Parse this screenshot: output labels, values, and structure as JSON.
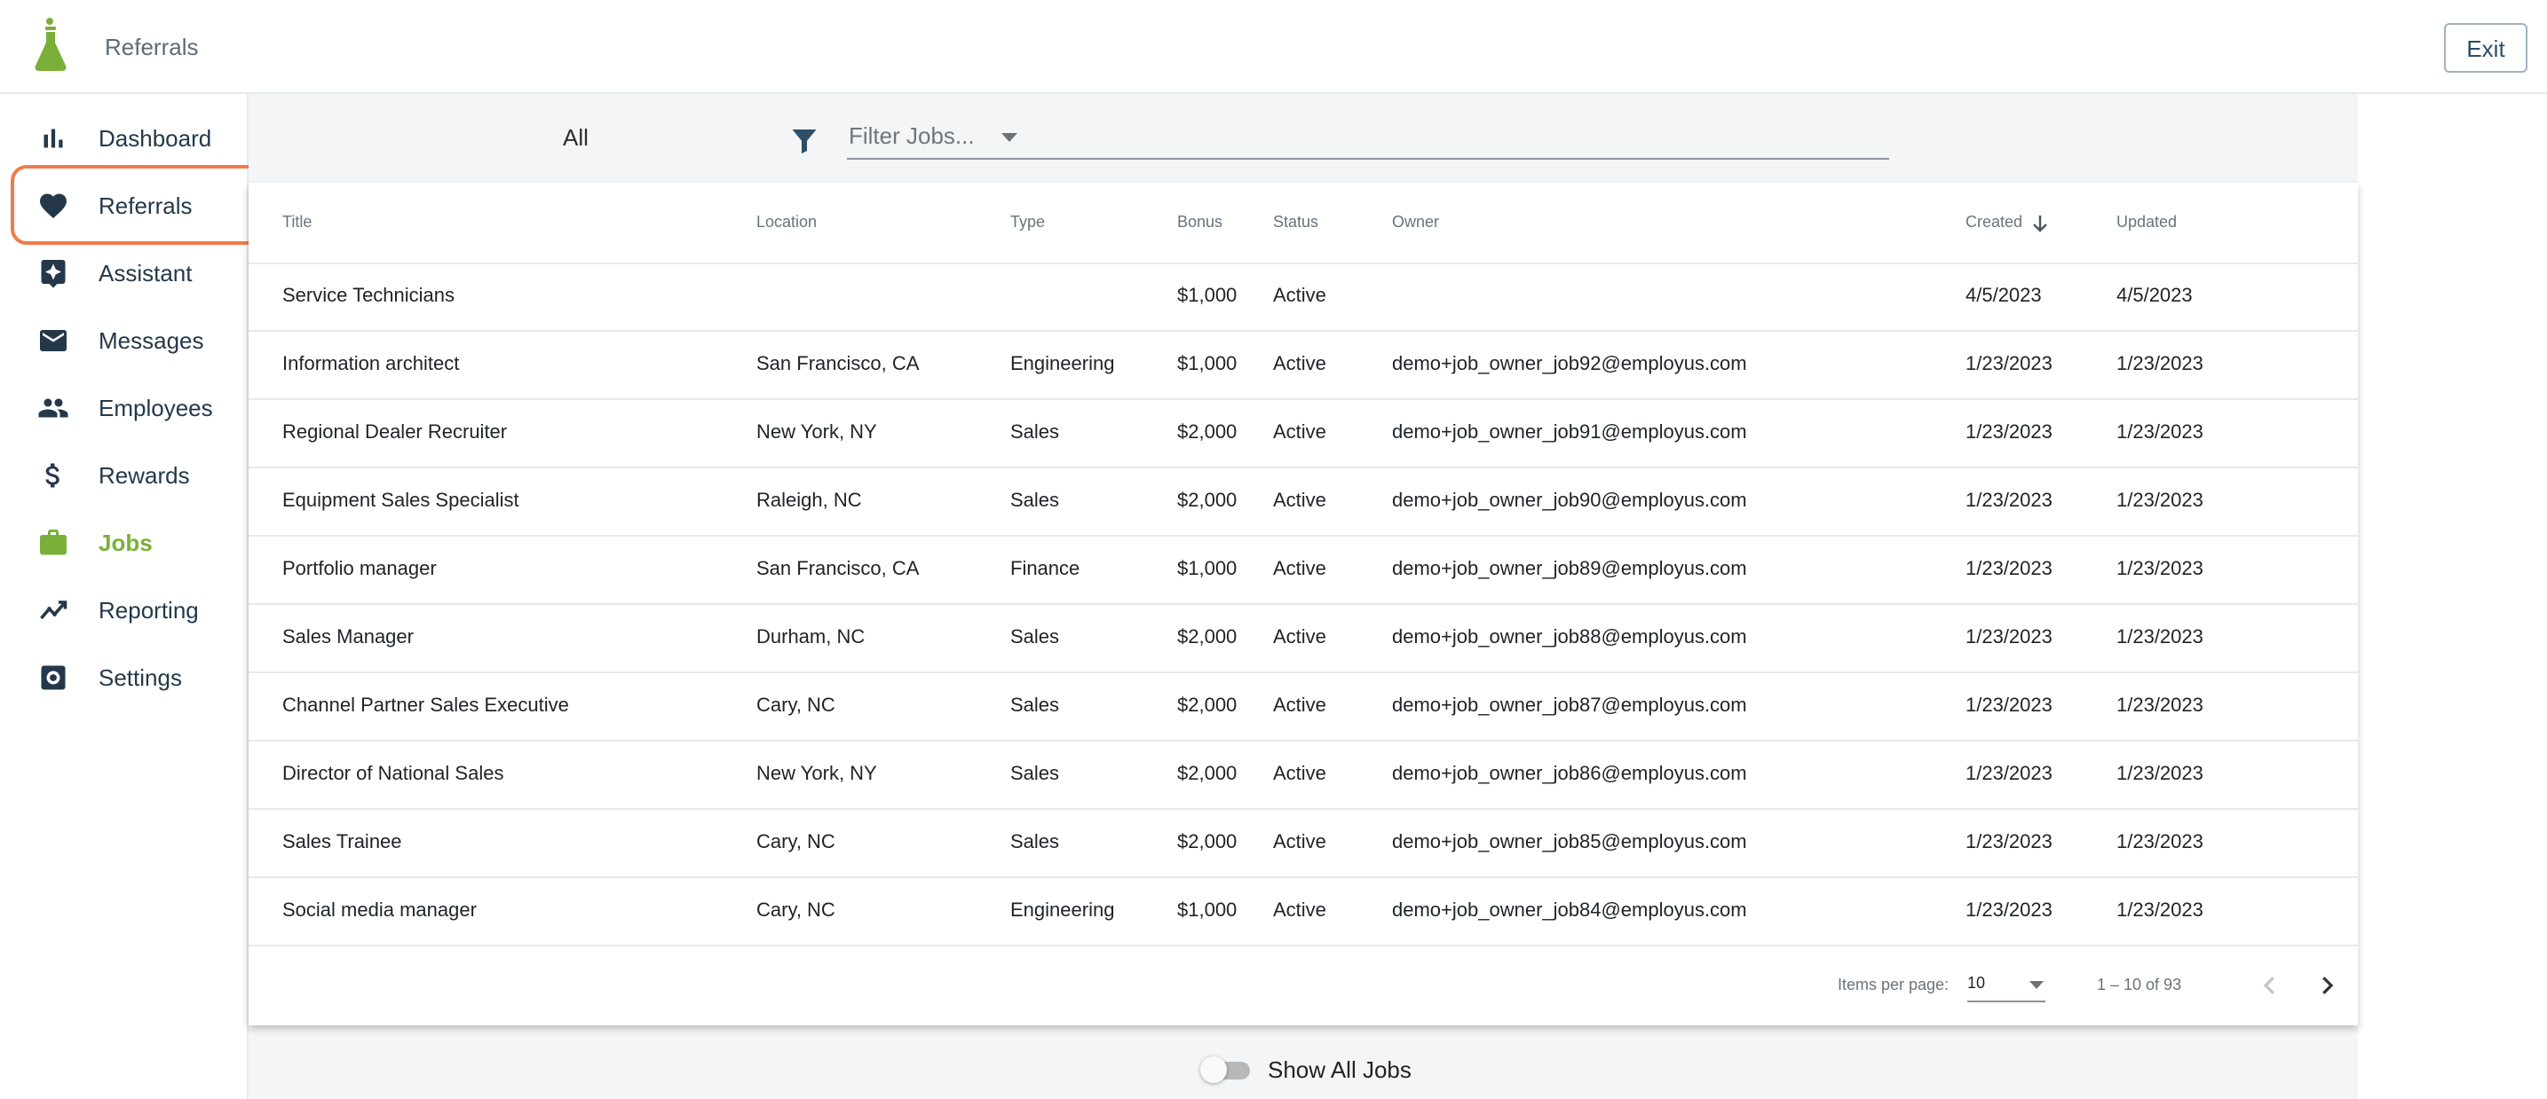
{
  "header": {
    "title": "Referrals",
    "exit_label": "Exit"
  },
  "sidebar": {
    "items": [
      {
        "label": "Dashboard",
        "icon": "bar-chart-icon",
        "active": false
      },
      {
        "label": "Referrals",
        "icon": "heart-icon",
        "active": false
      },
      {
        "label": "Assistant",
        "icon": "assistant-icon",
        "active": false
      },
      {
        "label": "Messages",
        "icon": "mail-icon",
        "active": false
      },
      {
        "label": "Employees",
        "icon": "people-icon",
        "active": false
      },
      {
        "label": "Rewards",
        "icon": "dollar-icon",
        "active": false
      },
      {
        "label": "Jobs",
        "icon": "briefcase-icon",
        "active": true
      },
      {
        "label": "Reporting",
        "icon": "trending-icon",
        "active": false
      },
      {
        "label": "Settings",
        "icon": "settings-icon",
        "active": false
      }
    ]
  },
  "filter": {
    "select_value": "All",
    "placeholder": "Filter Jobs..."
  },
  "table": {
    "columns": {
      "title": "Title",
      "location": "Location",
      "type": "Type",
      "bonus": "Bonus",
      "status": "Status",
      "owner": "Owner",
      "created": "Created",
      "updated": "Updated"
    },
    "sort_column": "created",
    "sort_direction": "desc",
    "rows": [
      {
        "title": "Service Technicians",
        "location": "",
        "type": "",
        "bonus": "$1,000",
        "status": "Active",
        "owner": "",
        "created": "4/5/2023",
        "updated": "4/5/2023"
      },
      {
        "title": "Information architect",
        "location": "San Francisco, CA",
        "type": "Engineering",
        "bonus": "$1,000",
        "status": "Active",
        "owner": "demo+job_owner_job92@employus.com",
        "created": "1/23/2023",
        "updated": "1/23/2023"
      },
      {
        "title": "Regional Dealer Recruiter",
        "location": "New York, NY",
        "type": "Sales",
        "bonus": "$2,000",
        "status": "Active",
        "owner": "demo+job_owner_job91@employus.com",
        "created": "1/23/2023",
        "updated": "1/23/2023"
      },
      {
        "title": "Equipment Sales Specialist",
        "location": "Raleigh, NC",
        "type": "Sales",
        "bonus": "$2,000",
        "status": "Active",
        "owner": "demo+job_owner_job90@employus.com",
        "created": "1/23/2023",
        "updated": "1/23/2023"
      },
      {
        "title": "Portfolio manager",
        "location": "San Francisco, CA",
        "type": "Finance",
        "bonus": "$1,000",
        "status": "Active",
        "owner": "demo+job_owner_job89@employus.com",
        "created": "1/23/2023",
        "updated": "1/23/2023"
      },
      {
        "title": "Sales Manager",
        "location": "Durham, NC",
        "type": "Sales",
        "bonus": "$2,000",
        "status": "Active",
        "owner": "demo+job_owner_job88@employus.com",
        "created": "1/23/2023",
        "updated": "1/23/2023"
      },
      {
        "title": "Channel Partner Sales Executive",
        "location": "Cary, NC",
        "type": "Sales",
        "bonus": "$2,000",
        "status": "Active",
        "owner": "demo+job_owner_job87@employus.com",
        "created": "1/23/2023",
        "updated": "1/23/2023"
      },
      {
        "title": "Director of National Sales",
        "location": "New York, NY",
        "type": "Sales",
        "bonus": "$2,000",
        "status": "Active",
        "owner": "demo+job_owner_job86@employus.com",
        "created": "1/23/2023",
        "updated": "1/23/2023"
      },
      {
        "title": "Sales Trainee",
        "location": "Cary, NC",
        "type": "Sales",
        "bonus": "$2,000",
        "status": "Active",
        "owner": "demo+job_owner_job85@employus.com",
        "created": "1/23/2023",
        "updated": "1/23/2023"
      },
      {
        "title": "Social media manager",
        "location": "Cary, NC",
        "type": "Engineering",
        "bonus": "$1,000",
        "status": "Active",
        "owner": "demo+job_owner_job84@employus.com",
        "created": "1/23/2023",
        "updated": "1/23/2023"
      }
    ]
  },
  "paginator": {
    "items_label": "Items per page:",
    "page_size": "10",
    "range": "1 – 10 of 93"
  },
  "toggle": {
    "label": "Show All Jobs",
    "on": false
  },
  "colors": {
    "accent": "#7ab03a",
    "nav": "#24384a",
    "highlight": "#f07b4a",
    "content_bg": "#f3f5f6"
  }
}
